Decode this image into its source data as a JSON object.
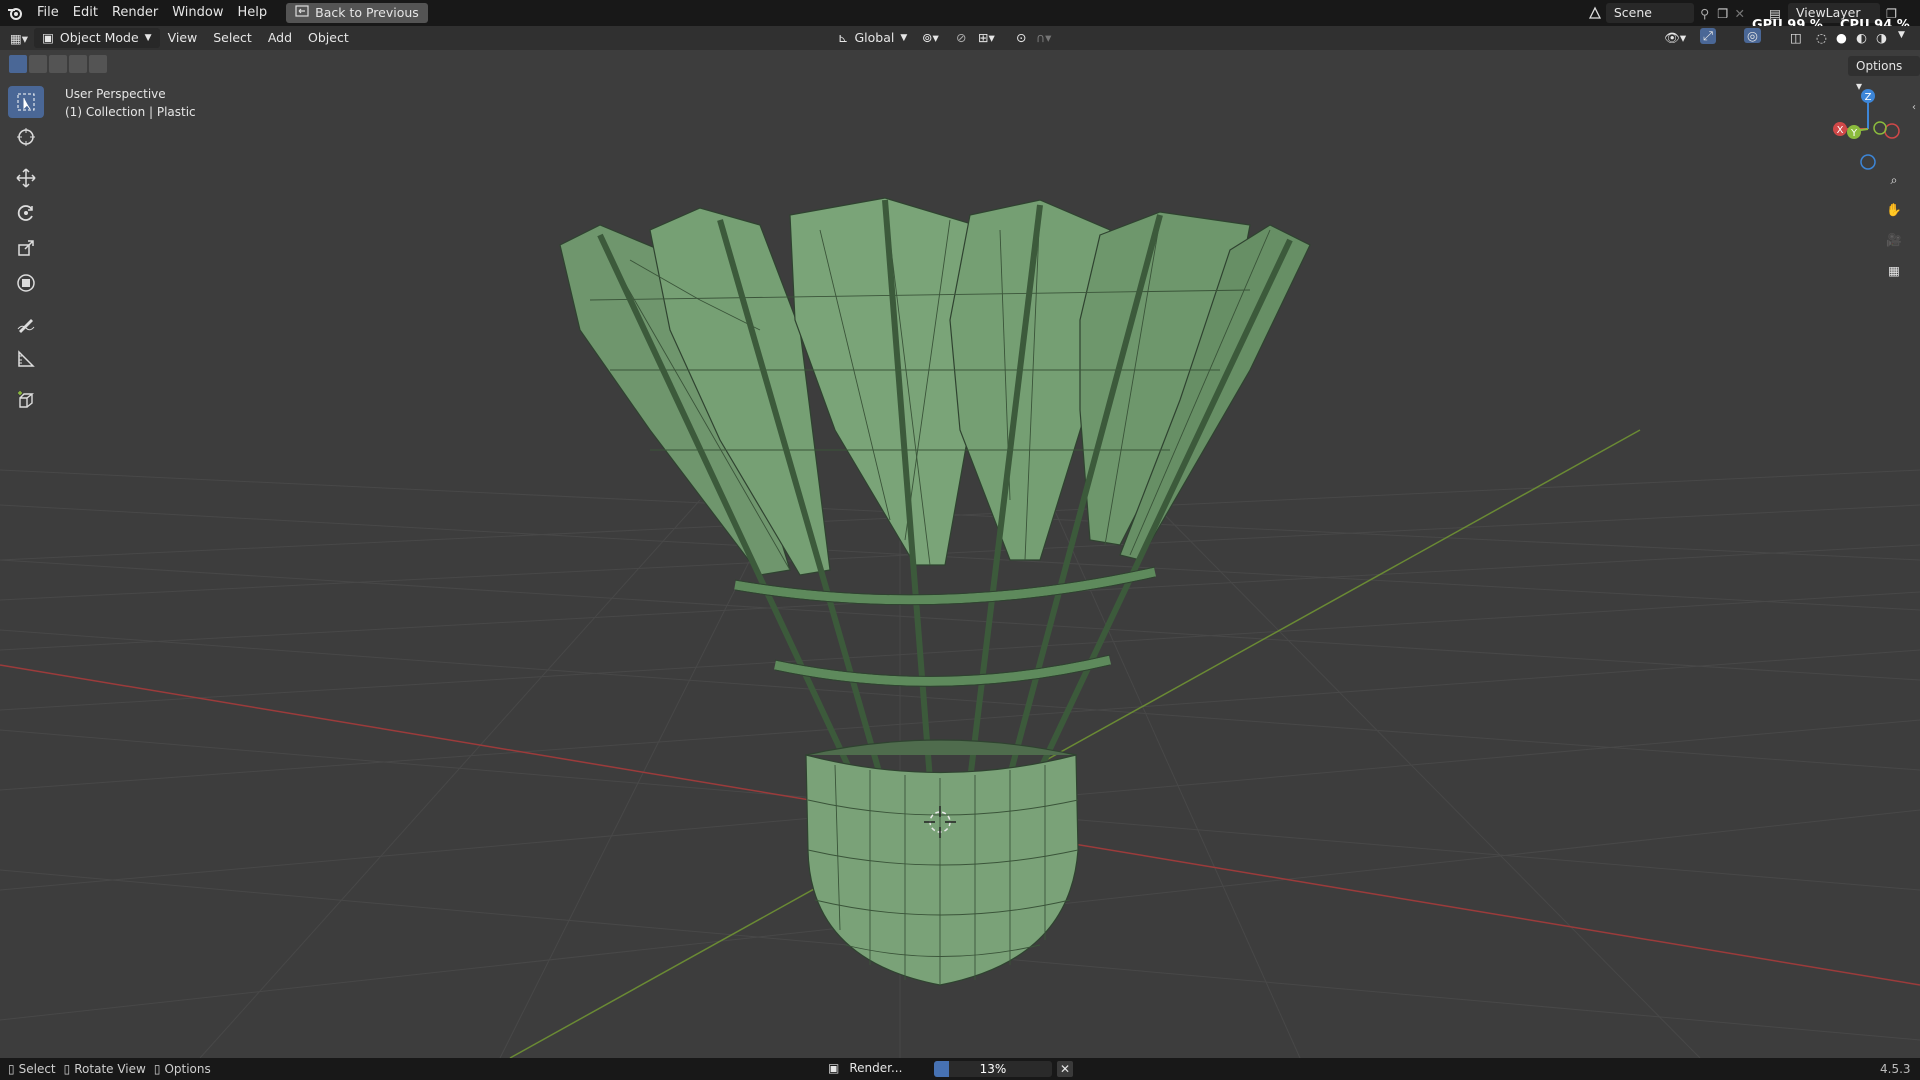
{
  "topbar": {
    "menus": [
      "File",
      "Edit",
      "Render",
      "Window",
      "Help"
    ],
    "back_button": "Back to Previous",
    "scene": "Scene",
    "view_layer": "ViewLayer",
    "gpu": "GPU 99 %",
    "cpu": "CPU 94 %"
  },
  "header": {
    "mode": "Object Mode",
    "menus": [
      "View",
      "Select",
      "Add",
      "Object"
    ],
    "orientation": "Global",
    "options": "Options"
  },
  "viewport": {
    "perspective": "User Perspective",
    "collection": "(1) Collection | Plastic",
    "gizmo": {
      "x": "X",
      "y": "Y",
      "z": "Z"
    }
  },
  "status": {
    "select": "Select",
    "rotate": "Rotate View",
    "options": "Options",
    "render_label": "Render...",
    "progress_text": "13%",
    "progress_fraction": 0.13,
    "version": "4.5.3"
  },
  "colors": {
    "accent": "#4772b3",
    "mesh": "#7aa278",
    "mesh_dark": "#4f6c4d",
    "x_axis": "#d04848",
    "y_axis": "#8bbb3d",
    "z_axis": "#3d86d8"
  }
}
